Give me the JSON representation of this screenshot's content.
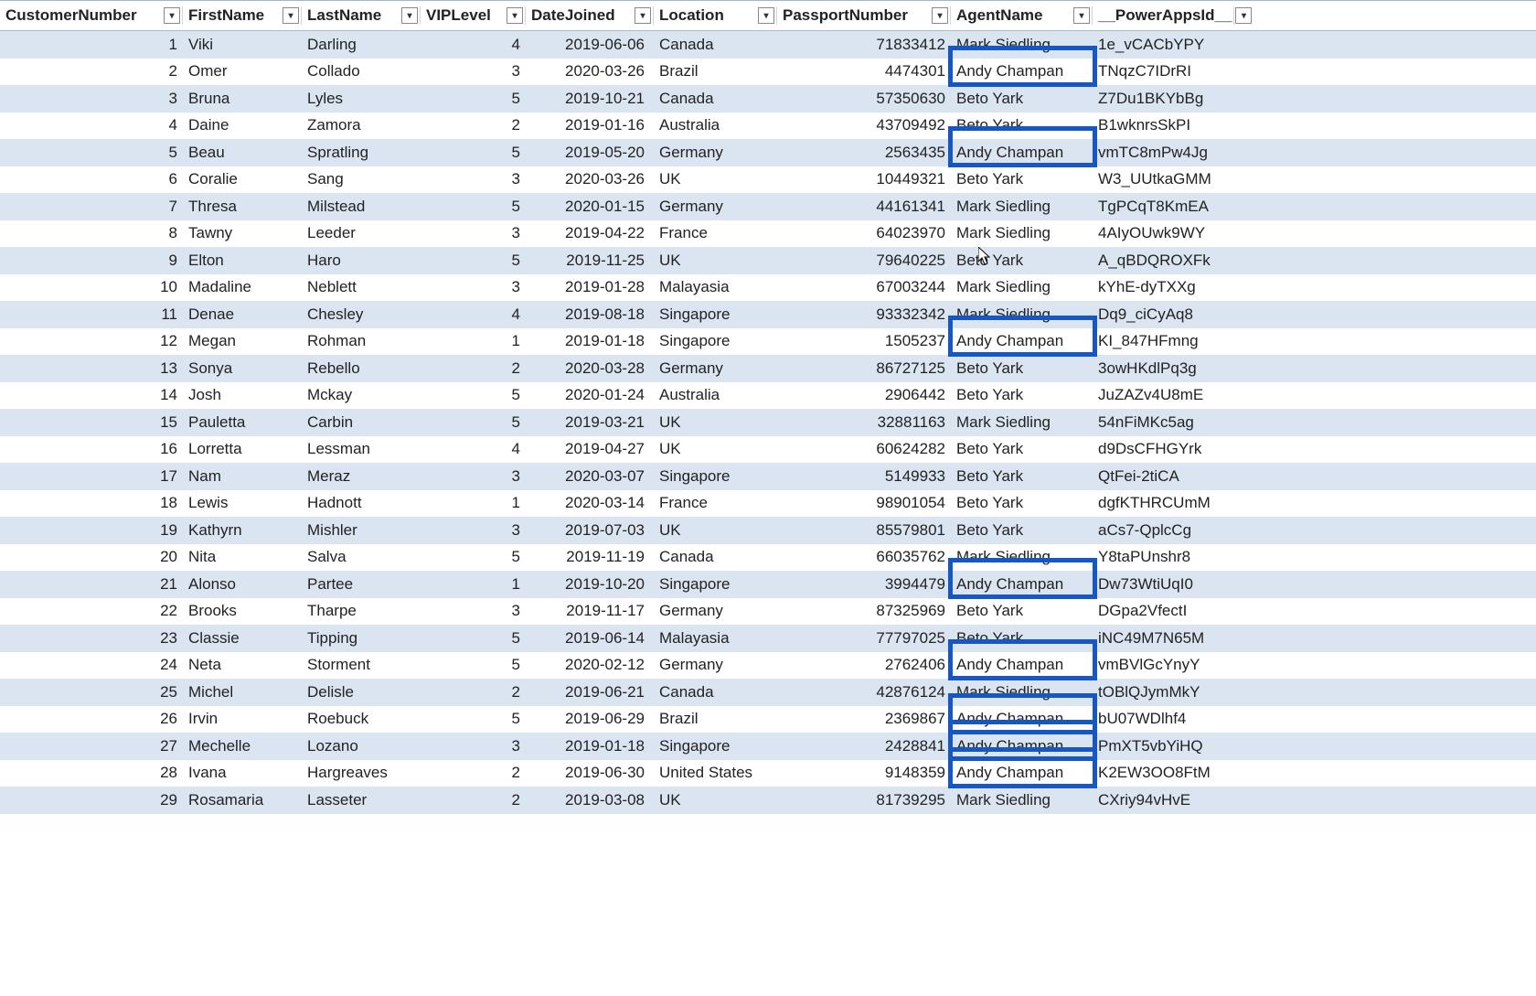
{
  "columns": [
    {
      "key": "CustomerNumber",
      "label": "CustomerNumber",
      "cls": "c0",
      "type": "num",
      "bindIndex": 0
    },
    {
      "key": "FirstName",
      "label": "FirstName",
      "cls": "c1",
      "type": "text",
      "bindIndex": 1
    },
    {
      "key": "LastName",
      "label": "LastName",
      "cls": "c2",
      "type": "text",
      "bindIndex": 2
    },
    {
      "key": "VIPLevel",
      "label": "VIPLevel",
      "cls": "c3",
      "type": "num",
      "bindIndex": 3
    },
    {
      "key": "DateJoined",
      "label": "DateJoined",
      "cls": "c4",
      "type": "date",
      "bindIndex": 4
    },
    {
      "key": "Location",
      "label": "Location",
      "cls": "c5",
      "type": "text",
      "bindIndex": 5
    },
    {
      "key": "PassportNumber",
      "label": "PassportNumber",
      "cls": "c6",
      "type": "num",
      "bindIndex": 6
    },
    {
      "key": "AgentName",
      "label": "AgentName",
      "cls": "c7",
      "type": "text",
      "bindIndex": 7
    },
    {
      "key": "PowerAppsId",
      "label": "__PowerAppsId__",
      "cls": "c8",
      "type": "text",
      "bindIndex": 8
    }
  ],
  "dropdown_glyph": "▾",
  "rows": [
    [
      1,
      "Viki",
      "Darling",
      4,
      "2019-06-06",
      "Canada",
      71833412,
      "Mark Siedling",
      "1e_vCACbYPY"
    ],
    [
      2,
      "Omer",
      "Collado",
      3,
      "2020-03-26",
      "Brazil",
      4474301,
      "Andy Champan",
      "TNqzC7IDrRI"
    ],
    [
      3,
      "Bruna",
      "Lyles",
      5,
      "2019-10-21",
      "Canada",
      57350630,
      "Beto Yark",
      "Z7Du1BKYbBg"
    ],
    [
      4,
      "Daine",
      "Zamora",
      2,
      "2019-01-16",
      "Australia",
      43709492,
      "Beto Yark",
      "B1wknrsSkPI"
    ],
    [
      5,
      "Beau",
      "Spratling",
      5,
      "2019-05-20",
      "Germany",
      2563435,
      "Andy Champan",
      "vmTC8mPw4Jg"
    ],
    [
      6,
      "Coralie",
      "Sang",
      3,
      "2020-03-26",
      "UK",
      10449321,
      "Beto Yark",
      "W3_UUtkaGMM"
    ],
    [
      7,
      "Thresa",
      "Milstead",
      5,
      "2020-01-15",
      "Germany",
      44161341,
      "Mark Siedling",
      "TgPCqT8KmEA"
    ],
    [
      8,
      "Tawny",
      "Leeder",
      3,
      "2019-04-22",
      "France",
      64023970,
      "Mark Siedling",
      "4AIyOUwk9WY"
    ],
    [
      9,
      "Elton",
      "Haro",
      5,
      "2019-11-25",
      "UK",
      79640225,
      "Beto Yark",
      "A_qBDQROXFk"
    ],
    [
      10,
      "Madaline",
      "Neblett",
      3,
      "2019-01-28",
      "Malayasia",
      67003244,
      "Mark Siedling",
      "kYhE-dyTXXg"
    ],
    [
      11,
      "Denae",
      "Chesley",
      4,
      "2019-08-18",
      "Singapore",
      93332342,
      "Mark Siedling",
      "Dq9_ciCyAq8"
    ],
    [
      12,
      "Megan",
      "Rohman",
      1,
      "2019-01-18",
      "Singapore",
      1505237,
      "Andy Champan",
      "KI_847HFmng"
    ],
    [
      13,
      "Sonya",
      "Rebello",
      2,
      "2020-03-28",
      "Germany",
      86727125,
      "Beto Yark",
      "3owHKdlPq3g"
    ],
    [
      14,
      "Josh",
      "Mckay",
      5,
      "2020-01-24",
      "Australia",
      2906442,
      "Beto Yark",
      "JuZAZv4U8mE"
    ],
    [
      15,
      "Pauletta",
      "Carbin",
      5,
      "2019-03-21",
      "UK",
      32881163,
      "Mark Siedling",
      "54nFiMKc5ag"
    ],
    [
      16,
      "Lorretta",
      "Lessman",
      4,
      "2019-04-27",
      "UK",
      60624282,
      "Beto Yark",
      "d9DsCFHGYrk"
    ],
    [
      17,
      "Nam",
      "Meraz",
      3,
      "2020-03-07",
      "Singapore",
      5149933,
      "Beto Yark",
      "QtFei-2tiCA"
    ],
    [
      18,
      "Lewis",
      "Hadnott",
      1,
      "2020-03-14",
      "France",
      98901054,
      "Beto Yark",
      "dgfKTHRCUmM"
    ],
    [
      19,
      "Kathyrn",
      "Mishler",
      3,
      "2019-07-03",
      "UK",
      85579801,
      "Beto Yark",
      "aCs7-QplcCg"
    ],
    [
      20,
      "Nita",
      "Salva",
      5,
      "2019-11-19",
      "Canada",
      66035762,
      "Mark Siedling",
      "Y8taPUnshr8"
    ],
    [
      21,
      "Alonso",
      "Partee",
      1,
      "2019-10-20",
      "Singapore",
      3994479,
      "Andy Champan",
      "Dw73WtiUqI0"
    ],
    [
      22,
      "Brooks",
      "Tharpe",
      3,
      "2019-11-17",
      "Germany",
      87325969,
      "Beto Yark",
      "DGpa2VfectI"
    ],
    [
      23,
      "Classie",
      "Tipping",
      5,
      "2019-06-14",
      "Malayasia",
      77797025,
      "Beto Yark",
      "iNC49M7N65M"
    ],
    [
      24,
      "Neta",
      "Storment",
      5,
      "2020-02-12",
      "Germany",
      2762406,
      "Andy Champan",
      "vmBVlGcYnyY"
    ],
    [
      25,
      "Michel",
      "Delisle",
      2,
      "2019-06-21",
      "Canada",
      42876124,
      "Mark Siedling",
      "tOBlQJymMkY"
    ],
    [
      26,
      "Irvin",
      "Roebuck",
      5,
      "2019-06-29",
      "Brazil",
      2369867,
      "Andy Champan",
      "bU07WDlhf4"
    ],
    [
      27,
      "Mechelle",
      "Lozano",
      3,
      "2019-01-18",
      "Singapore",
      2428841,
      "Andy Champan",
      "PmXT5vbYiHQ"
    ],
    [
      28,
      "Ivana",
      "Hargreaves",
      2,
      "2019-06-30",
      "United States",
      9148359,
      "Andy Champan",
      "K2EW3OO8FtM"
    ],
    [
      29,
      "Rosamaria",
      "Lasseter",
      2,
      "2019-03-08",
      "UK",
      81739295,
      "Mark Siedling",
      "CXriy94vHvE"
    ]
  ],
  "highlight_rows": [
    1,
    4,
    11,
    20,
    23,
    25,
    26,
    27
  ],
  "cursor_row": 8
}
